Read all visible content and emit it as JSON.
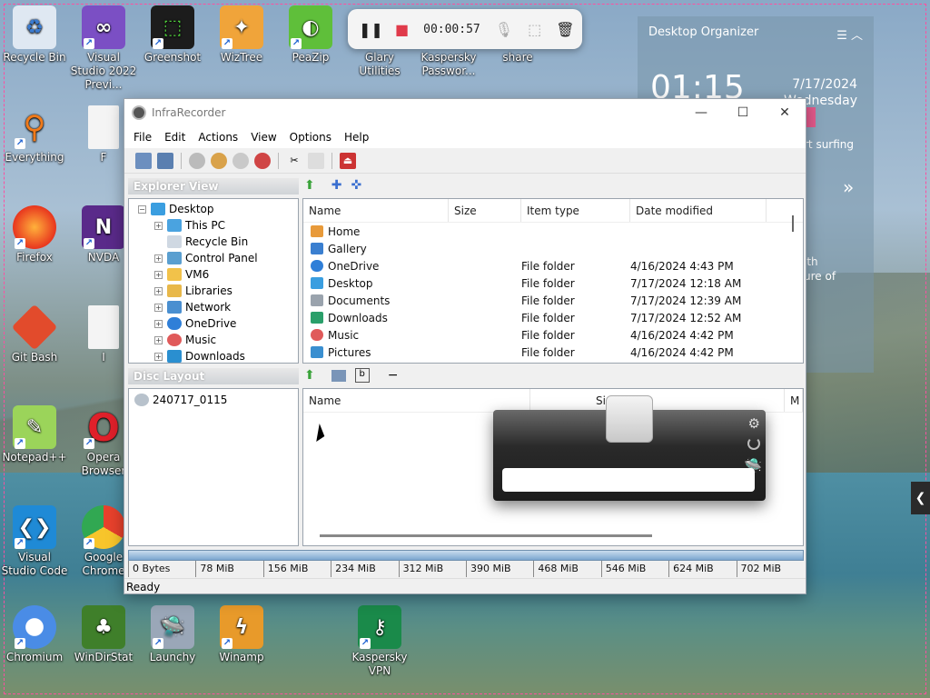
{
  "desktop": {
    "icons": [
      {
        "label": "Recycle Bin"
      },
      {
        "label": "Visual Studio 2022 Previ..."
      },
      {
        "label": "Greenshot"
      },
      {
        "label": "WizTree"
      },
      {
        "label": "PeaZip"
      },
      {
        "label": "Glary Utilities"
      },
      {
        "label": "Kaspersky Passwor..."
      },
      {
        "label": "share"
      },
      {
        "label": "Everything"
      },
      {
        "label": "F"
      },
      {
        "label": "Firefox"
      },
      {
        "label": "NVDA"
      },
      {
        "label": "Git Bash"
      },
      {
        "label": "I"
      },
      {
        "label": "Notepad++"
      },
      {
        "label": "Opera Browser"
      },
      {
        "label": "Visual Studio Code"
      },
      {
        "label": "Google Chrome"
      },
      {
        "label": "Chromium"
      },
      {
        "label": "WinDirStat"
      },
      {
        "label": "Launchy"
      },
      {
        "label": "Winamp"
      },
      {
        "label": "Kaspersky VPN"
      }
    ]
  },
  "recorder": {
    "time": "00:00:57"
  },
  "organizer": {
    "title": "Desktop Organizer",
    "clock": "01:15",
    "date": "7/17/2024",
    "weekday": "Wednesday",
    "note1": "rt surfing",
    "note2a": "ith",
    "note2b": "ure of"
  },
  "window": {
    "title": "InfraRecorder",
    "menu": [
      "File",
      "Edit",
      "Actions",
      "View",
      "Options",
      "Help"
    ],
    "explorer_header": "Explorer View",
    "disc_header": "Disc Layout",
    "tree": [
      "Desktop",
      "This PC",
      "Recycle Bin",
      "Control Panel",
      "VM6",
      "Libraries",
      "Network",
      "OneDrive",
      "Music",
      "Downloads"
    ],
    "columns": {
      "name": "Name",
      "size": "Size",
      "type": "Item type",
      "date": "Date modified"
    },
    "files": [
      {
        "name": "Home",
        "type": "",
        "date": ""
      },
      {
        "name": "Gallery",
        "type": "",
        "date": ""
      },
      {
        "name": "OneDrive",
        "type": "File folder",
        "date": "4/16/2024 4:43 PM"
      },
      {
        "name": "Desktop",
        "type": "File folder",
        "date": "7/17/2024 12:18 AM"
      },
      {
        "name": "Documents",
        "type": "File folder",
        "date": "7/17/2024 12:39 AM"
      },
      {
        "name": "Downloads",
        "type": "File folder",
        "date": "7/17/2024 12:52 AM"
      },
      {
        "name": "Music",
        "type": "File folder",
        "date": "4/16/2024 4:42 PM"
      },
      {
        "name": "Pictures",
        "type": "File folder",
        "date": "4/16/2024 4:42 PM"
      }
    ],
    "disc_item": "240717_0115",
    "disc_columns": {
      "name": "Name",
      "size": "Si",
      "m": "M"
    },
    "scale": [
      "0 Bytes",
      "78 MiB",
      "156 MiB",
      "234 MiB",
      "312 MiB",
      "390 MiB",
      "468 MiB",
      "546 MiB",
      "624 MiB",
      "702 MiB"
    ],
    "status": "Ready"
  }
}
